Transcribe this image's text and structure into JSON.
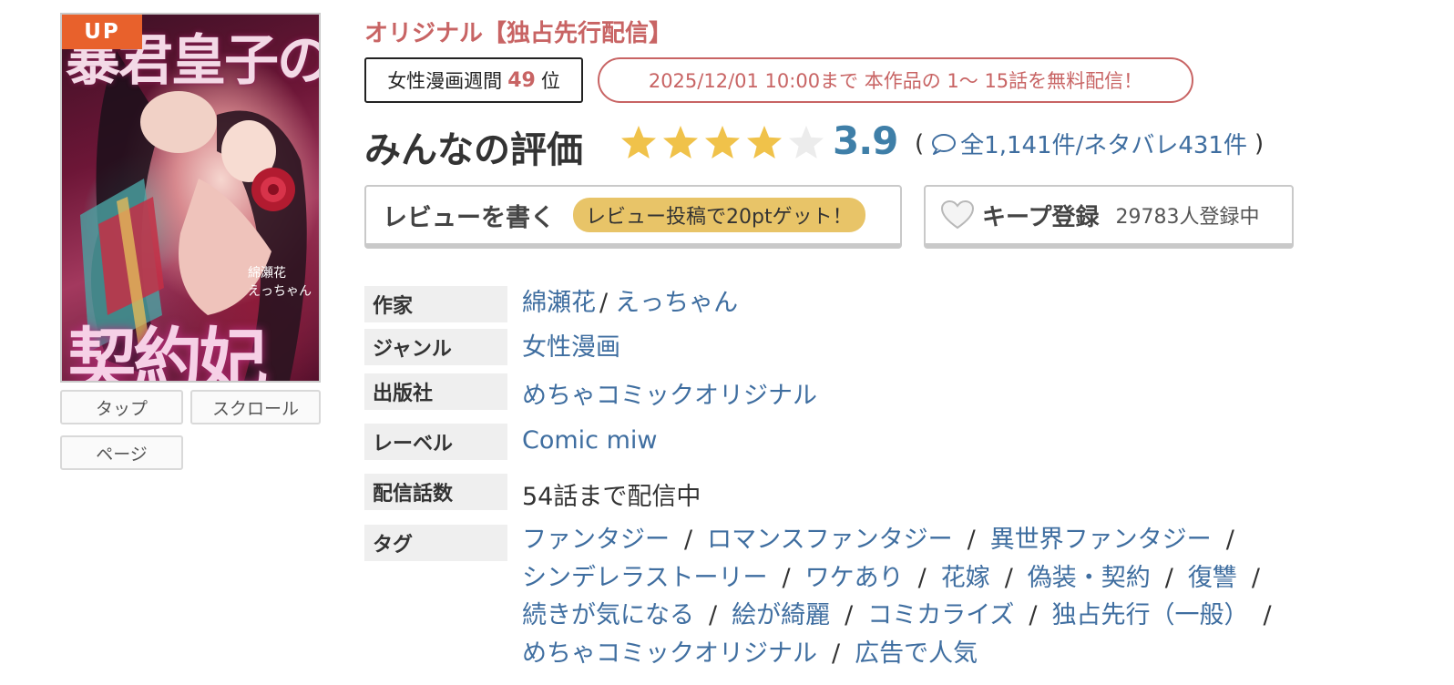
{
  "cover": {
    "badge": "UP",
    "title_top": "暴君皇子の",
    "title_bottom": "契約妃",
    "authors": [
      "綿瀬花",
      "えっちゃん"
    ]
  },
  "view_modes": [
    "タップ",
    "スクロール",
    "ページ"
  ],
  "original_label": "オリジナル【独占先行配信】",
  "ranking": {
    "prefix": "女性漫画週間",
    "rank": "49",
    "suffix": "位"
  },
  "free_notice": "2025/12/01 10:00まで 本作品の 1〜 15話を無料配信！",
  "rating": {
    "label": "みんなの評価",
    "score": "3.9",
    "stars_filled": 4,
    "stars_total": 5,
    "open_paren": "(",
    "close_paren": ")",
    "reviews": "全1,141件/ネタバレ431件"
  },
  "review_button": {
    "label": "レビューを書く",
    "bonus": "レビュー投稿で20ptゲット！"
  },
  "keep_button": {
    "label": "キープ登録",
    "count": "29783人登録中"
  },
  "details": {
    "author_label": "作家",
    "authors": [
      "綿瀬花",
      "えっちゃん"
    ],
    "author_sep": "/",
    "genre_label": "ジャンル",
    "genre": "女性漫画",
    "publisher_label": "出版社",
    "publisher": "めちゃコミックオリジナル",
    "imprint_label": "レーベル",
    "imprint": "Comic miw",
    "episodes_label": "配信話数",
    "episodes": "54話まで配信中",
    "tags_label": "タグ",
    "tag_sep": "/",
    "tags": [
      "ファンタジー",
      "ロマンスファンタジー",
      "異世界ファンタジー",
      "シンデレラストーリー",
      "ワケあり",
      "花嫁",
      "偽装・契約",
      "復讐",
      "続きが気になる",
      "絵が綺麗",
      "コミカライズ",
      "独占先行（一般）",
      "めちゃコミックオリジナル",
      "広告で人気"
    ]
  },
  "colors": {
    "accent_red": "#c86464",
    "link_blue": "#3f6ea0",
    "score_blue": "#3f7fa8",
    "star_gold": "#f0c24a",
    "star_empty": "#ececec",
    "bonus_pill": "#e8c468",
    "up_badge": "#e8612c"
  }
}
